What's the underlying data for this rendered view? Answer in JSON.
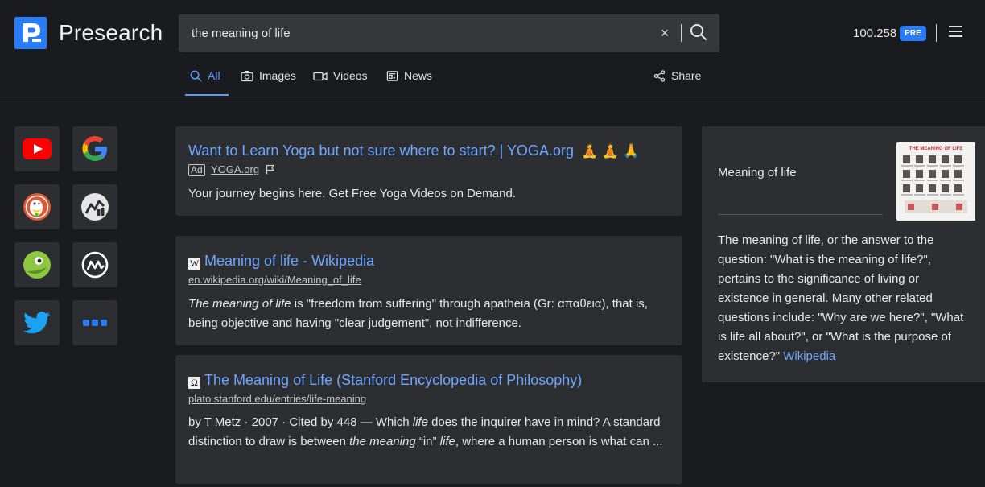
{
  "header": {
    "brand": "Presearch",
    "search": {
      "value": "the meaning of life",
      "placeholder": ""
    },
    "clear_symbol": "×",
    "balance": "100.258",
    "token_badge": "PRE"
  },
  "tabs": [
    {
      "label": "All",
      "icon": "search-icon",
      "active": true
    },
    {
      "label": "Images",
      "icon": "camera-icon"
    },
    {
      "label": "Videos",
      "icon": "video-icon"
    },
    {
      "label": "News",
      "icon": "newspaper-icon"
    }
  ],
  "share_label": "Share",
  "engines": [
    {
      "name": "youtube",
      "color": "#ff0000"
    },
    {
      "name": "google",
      "color": "#4285f4"
    },
    {
      "name": "duckduckgo",
      "color": "#de5833"
    },
    {
      "name": "coinmarketcap-style",
      "color": "#d9d9d9"
    },
    {
      "name": "gecko",
      "color": "#8dc63f"
    },
    {
      "name": "coinmarketcap",
      "color": "#ffffff"
    },
    {
      "name": "twitter",
      "color": "#1da1f2"
    },
    {
      "name": "more",
      "color": "#2a7cf6"
    }
  ],
  "results": [
    {
      "ad": true,
      "title": "Want to Learn Yoga but not sure where to start? | YOGA.org",
      "title_emoji": "🧘 🧘 🙏",
      "ad_label": "Ad",
      "url": "YOGA.org",
      "description": "Your journey begins here. Get Free Yoga Videos on Demand."
    },
    {
      "favicon": "W",
      "title": "Meaning of life - Wikipedia",
      "url": "en.wikipedia.org/wiki/Meaning_of_life",
      "description_parts": [
        {
          "text": "The meaning of life",
          "italic": true
        },
        {
          "text": " is \"freedom from suffering\" through apatheia (Gr: απαθεια), that is, being objective and having \"clear judgement\", not indifference.",
          "italic": false
        }
      ]
    },
    {
      "favicon": "Ω",
      "title": "The Meaning of Life (Stanford Encyclopedia of Philosophy)",
      "url": "plato.stanford.edu/entries/life-meaning",
      "description_parts": [
        {
          "text": "by T Metz · 2007 · Cited by 448 — Which ",
          "italic": false
        },
        {
          "text": "life",
          "italic": true
        },
        {
          "text": " does the inquirer have in mind? A standard distinction to draw is between ",
          "italic": false
        },
        {
          "text": "the meaning",
          "italic": true
        },
        {
          "text": " “in” ",
          "italic": false
        },
        {
          "text": "life",
          "italic": true
        },
        {
          "text": ", where a human person is what can ...",
          "italic": false
        }
      ]
    }
  ],
  "knowledge_panel": {
    "title": "Meaning of life",
    "image_caption": "THE MEANING OF LIFE",
    "text": "The meaning of life, or the answer to the question: \"What is the meaning of life?\", pertains to the significance of living or existence in general. Many other related questions include: \"Why are we here?\", \"What is life all about?\", or \"What is the purpose of existence?\"",
    "source_link": "Wikipedia"
  },
  "colors": {
    "accent": "#2a7cf6",
    "link": "#6ea7ff",
    "card": "#2d2e32",
    "bg": "#1a1b1e"
  }
}
